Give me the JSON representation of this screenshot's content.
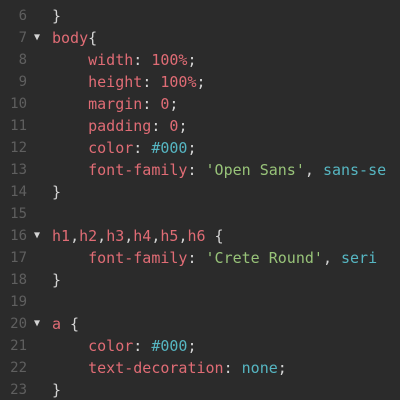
{
  "lines": [
    {
      "number": "6",
      "fold": "",
      "indent": "",
      "tokens": [
        {
          "t": "}",
          "c": "punc"
        }
      ]
    },
    {
      "number": "7",
      "fold": "▼",
      "indent": "",
      "tokens": [
        {
          "t": "body",
          "c": "sel"
        },
        {
          "t": "{",
          "c": "punc"
        }
      ]
    },
    {
      "number": "8",
      "fold": "",
      "indent": "    ",
      "tokens": [
        {
          "t": "width",
          "c": "prop"
        },
        {
          "t": ": ",
          "c": "punc"
        },
        {
          "t": "100%",
          "c": "num"
        },
        {
          "t": ";",
          "c": "punc"
        }
      ]
    },
    {
      "number": "9",
      "fold": "",
      "indent": "    ",
      "tokens": [
        {
          "t": "height",
          "c": "prop"
        },
        {
          "t": ": ",
          "c": "punc"
        },
        {
          "t": "100%",
          "c": "num"
        },
        {
          "t": ";",
          "c": "punc"
        }
      ]
    },
    {
      "number": "10",
      "fold": "",
      "indent": "    ",
      "tokens": [
        {
          "t": "margin",
          "c": "prop"
        },
        {
          "t": ": ",
          "c": "punc"
        },
        {
          "t": "0",
          "c": "num"
        },
        {
          "t": ";",
          "c": "punc"
        }
      ]
    },
    {
      "number": "11",
      "fold": "",
      "indent": "    ",
      "tokens": [
        {
          "t": "padding",
          "c": "prop"
        },
        {
          "t": ": ",
          "c": "punc"
        },
        {
          "t": "0",
          "c": "num"
        },
        {
          "t": ";",
          "c": "punc"
        }
      ]
    },
    {
      "number": "12",
      "fold": "",
      "indent": "    ",
      "tokens": [
        {
          "t": "color",
          "c": "prop"
        },
        {
          "t": ": ",
          "c": "punc"
        },
        {
          "t": "#000",
          "c": "hex"
        },
        {
          "t": ";",
          "c": "punc"
        }
      ]
    },
    {
      "number": "13",
      "fold": "",
      "indent": "    ",
      "tokens": [
        {
          "t": "font-family",
          "c": "prop"
        },
        {
          "t": ": ",
          "c": "punc"
        },
        {
          "t": "'Open Sans'",
          "c": "str"
        },
        {
          "t": ", ",
          "c": "punc"
        },
        {
          "t": "sans-se",
          "c": "kw"
        }
      ]
    },
    {
      "number": "14",
      "fold": "",
      "indent": "",
      "tokens": [
        {
          "t": "}",
          "c": "punc"
        }
      ]
    },
    {
      "number": "15",
      "fold": "",
      "indent": "",
      "tokens": []
    },
    {
      "number": "16",
      "fold": "▼",
      "indent": "",
      "tokens": [
        {
          "t": "h1",
          "c": "sel"
        },
        {
          "t": ",",
          "c": "punc"
        },
        {
          "t": "h2",
          "c": "sel"
        },
        {
          "t": ",",
          "c": "punc"
        },
        {
          "t": "h3",
          "c": "sel"
        },
        {
          "t": ",",
          "c": "punc"
        },
        {
          "t": "h4",
          "c": "sel"
        },
        {
          "t": ",",
          "c": "punc"
        },
        {
          "t": "h5",
          "c": "sel"
        },
        {
          "t": ",",
          "c": "punc"
        },
        {
          "t": "h6",
          "c": "sel"
        },
        {
          "t": " {",
          "c": "punc"
        }
      ]
    },
    {
      "number": "17",
      "fold": "",
      "indent": "    ",
      "tokens": [
        {
          "t": "font-family",
          "c": "prop"
        },
        {
          "t": ": ",
          "c": "punc"
        },
        {
          "t": "'Crete Round'",
          "c": "str"
        },
        {
          "t": ", ",
          "c": "punc"
        },
        {
          "t": "seri",
          "c": "kw"
        }
      ]
    },
    {
      "number": "18",
      "fold": "",
      "indent": "",
      "tokens": [
        {
          "t": "}",
          "c": "punc"
        }
      ]
    },
    {
      "number": "19",
      "fold": "",
      "indent": "",
      "tokens": []
    },
    {
      "number": "20",
      "fold": "▼",
      "indent": "",
      "tokens": [
        {
          "t": "a",
          "c": "sel"
        },
        {
          "t": " {",
          "c": "punc"
        }
      ]
    },
    {
      "number": "21",
      "fold": "",
      "indent": "    ",
      "tokens": [
        {
          "t": "color",
          "c": "prop"
        },
        {
          "t": ": ",
          "c": "punc"
        },
        {
          "t": "#000",
          "c": "hex"
        },
        {
          "t": ";",
          "c": "punc"
        }
      ]
    },
    {
      "number": "22",
      "fold": "",
      "indent": "    ",
      "tokens": [
        {
          "t": "text-decoration",
          "c": "prop"
        },
        {
          "t": ": ",
          "c": "punc"
        },
        {
          "t": "none",
          "c": "kw"
        },
        {
          "t": ";",
          "c": "punc"
        }
      ]
    },
    {
      "number": "23",
      "fold": "",
      "indent": "",
      "tokens": [
        {
          "t": "}",
          "c": "punc"
        }
      ]
    }
  ],
  "colors": {
    "background": "#2b2b2b",
    "line_number": "#5f5f5f",
    "selector": "#e06c75",
    "property": "#e06c75",
    "number": "#e06c75",
    "hex_color": "#56b6c2",
    "string": "#98c379",
    "keyword": "#56b6c2",
    "punctuation": "#d4d4d4"
  }
}
